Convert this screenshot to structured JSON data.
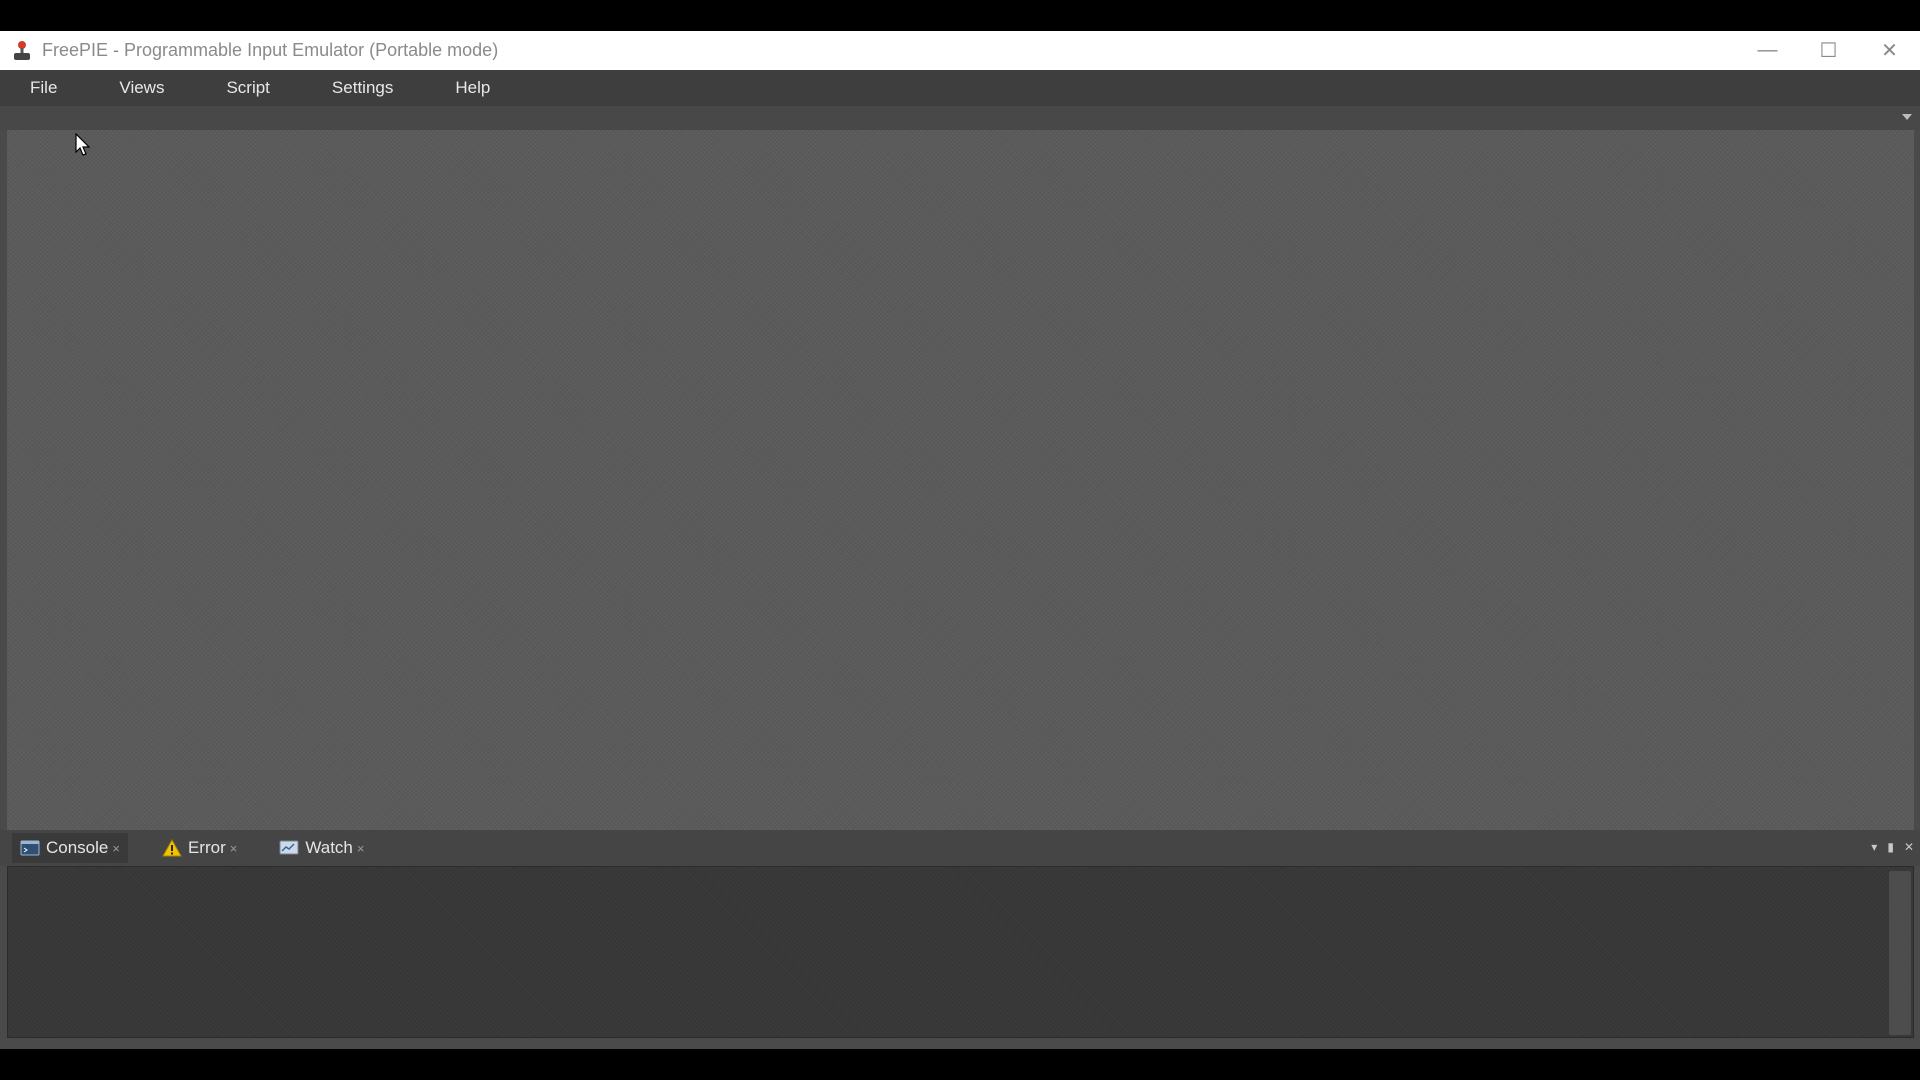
{
  "window": {
    "title": "FreePIE - Programmable Input Emulator (Portable mode)",
    "controls": {
      "minimize": "—",
      "maximize": "☐",
      "close": "✕"
    }
  },
  "menu": {
    "items": [
      {
        "label": "File"
      },
      {
        "label": "Views"
      },
      {
        "label": "Script"
      },
      {
        "label": "Settings"
      },
      {
        "label": "Help"
      }
    ]
  },
  "panel": {
    "tabs": [
      {
        "label": "Console",
        "icon": "console-icon",
        "close": "×"
      },
      {
        "label": "Error",
        "icon": "warning-icon",
        "close": "×"
      },
      {
        "label": "Watch",
        "icon": "watch-icon",
        "close": "×"
      }
    ],
    "controls": {
      "dropdown": "▾",
      "pin": "▮",
      "close": "✕"
    }
  },
  "colors": {
    "menubar": "#3e3e3e",
    "doc_area": "#5a5a5a",
    "panel_body": "#363636",
    "warning": "#f2c400"
  }
}
